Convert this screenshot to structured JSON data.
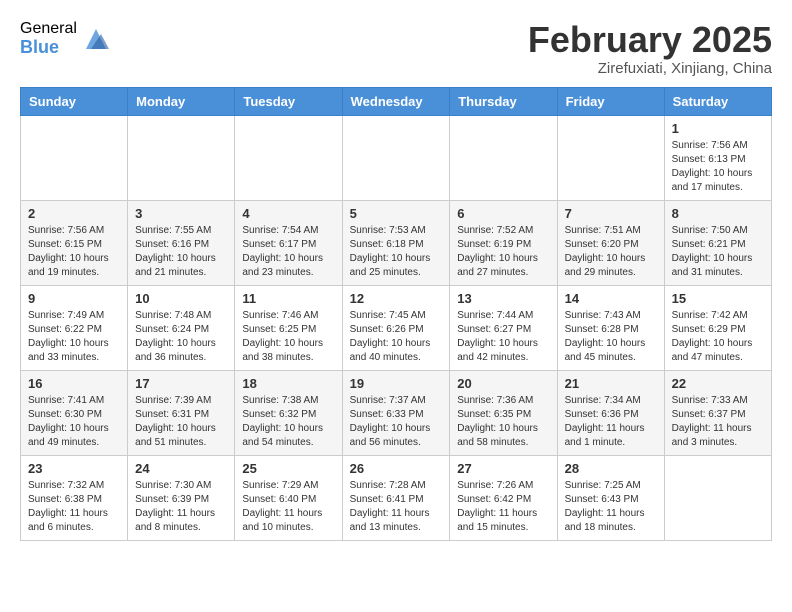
{
  "header": {
    "logo_general": "General",
    "logo_blue": "Blue",
    "month_title": "February 2025",
    "location": "Zirefuxiati, Xinjiang, China"
  },
  "calendar": {
    "days_of_week": [
      "Sunday",
      "Monday",
      "Tuesday",
      "Wednesday",
      "Thursday",
      "Friday",
      "Saturday"
    ],
    "weeks": [
      [
        {
          "day": "",
          "info": ""
        },
        {
          "day": "",
          "info": ""
        },
        {
          "day": "",
          "info": ""
        },
        {
          "day": "",
          "info": ""
        },
        {
          "day": "",
          "info": ""
        },
        {
          "day": "",
          "info": ""
        },
        {
          "day": "1",
          "info": "Sunrise: 7:56 AM\nSunset: 6:13 PM\nDaylight: 10 hours and 17 minutes."
        }
      ],
      [
        {
          "day": "2",
          "info": "Sunrise: 7:56 AM\nSunset: 6:15 PM\nDaylight: 10 hours and 19 minutes."
        },
        {
          "day": "3",
          "info": "Sunrise: 7:55 AM\nSunset: 6:16 PM\nDaylight: 10 hours and 21 minutes."
        },
        {
          "day": "4",
          "info": "Sunrise: 7:54 AM\nSunset: 6:17 PM\nDaylight: 10 hours and 23 minutes."
        },
        {
          "day": "5",
          "info": "Sunrise: 7:53 AM\nSunset: 6:18 PM\nDaylight: 10 hours and 25 minutes."
        },
        {
          "day": "6",
          "info": "Sunrise: 7:52 AM\nSunset: 6:19 PM\nDaylight: 10 hours and 27 minutes."
        },
        {
          "day": "7",
          "info": "Sunrise: 7:51 AM\nSunset: 6:20 PM\nDaylight: 10 hours and 29 minutes."
        },
        {
          "day": "8",
          "info": "Sunrise: 7:50 AM\nSunset: 6:21 PM\nDaylight: 10 hours and 31 minutes."
        }
      ],
      [
        {
          "day": "9",
          "info": "Sunrise: 7:49 AM\nSunset: 6:22 PM\nDaylight: 10 hours and 33 minutes."
        },
        {
          "day": "10",
          "info": "Sunrise: 7:48 AM\nSunset: 6:24 PM\nDaylight: 10 hours and 36 minutes."
        },
        {
          "day": "11",
          "info": "Sunrise: 7:46 AM\nSunset: 6:25 PM\nDaylight: 10 hours and 38 minutes."
        },
        {
          "day": "12",
          "info": "Sunrise: 7:45 AM\nSunset: 6:26 PM\nDaylight: 10 hours and 40 minutes."
        },
        {
          "day": "13",
          "info": "Sunrise: 7:44 AM\nSunset: 6:27 PM\nDaylight: 10 hours and 42 minutes."
        },
        {
          "day": "14",
          "info": "Sunrise: 7:43 AM\nSunset: 6:28 PM\nDaylight: 10 hours and 45 minutes."
        },
        {
          "day": "15",
          "info": "Sunrise: 7:42 AM\nSunset: 6:29 PM\nDaylight: 10 hours and 47 minutes."
        }
      ],
      [
        {
          "day": "16",
          "info": "Sunrise: 7:41 AM\nSunset: 6:30 PM\nDaylight: 10 hours and 49 minutes."
        },
        {
          "day": "17",
          "info": "Sunrise: 7:39 AM\nSunset: 6:31 PM\nDaylight: 10 hours and 51 minutes."
        },
        {
          "day": "18",
          "info": "Sunrise: 7:38 AM\nSunset: 6:32 PM\nDaylight: 10 hours and 54 minutes."
        },
        {
          "day": "19",
          "info": "Sunrise: 7:37 AM\nSunset: 6:33 PM\nDaylight: 10 hours and 56 minutes."
        },
        {
          "day": "20",
          "info": "Sunrise: 7:36 AM\nSunset: 6:35 PM\nDaylight: 10 hours and 58 minutes."
        },
        {
          "day": "21",
          "info": "Sunrise: 7:34 AM\nSunset: 6:36 PM\nDaylight: 11 hours and 1 minute."
        },
        {
          "day": "22",
          "info": "Sunrise: 7:33 AM\nSunset: 6:37 PM\nDaylight: 11 hours and 3 minutes."
        }
      ],
      [
        {
          "day": "23",
          "info": "Sunrise: 7:32 AM\nSunset: 6:38 PM\nDaylight: 11 hours and 6 minutes."
        },
        {
          "day": "24",
          "info": "Sunrise: 7:30 AM\nSunset: 6:39 PM\nDaylight: 11 hours and 8 minutes."
        },
        {
          "day": "25",
          "info": "Sunrise: 7:29 AM\nSunset: 6:40 PM\nDaylight: 11 hours and 10 minutes."
        },
        {
          "day": "26",
          "info": "Sunrise: 7:28 AM\nSunset: 6:41 PM\nDaylight: 11 hours and 13 minutes."
        },
        {
          "day": "27",
          "info": "Sunrise: 7:26 AM\nSunset: 6:42 PM\nDaylight: 11 hours and 15 minutes."
        },
        {
          "day": "28",
          "info": "Sunrise: 7:25 AM\nSunset: 6:43 PM\nDaylight: 11 hours and 18 minutes."
        },
        {
          "day": "",
          "info": ""
        }
      ]
    ]
  }
}
